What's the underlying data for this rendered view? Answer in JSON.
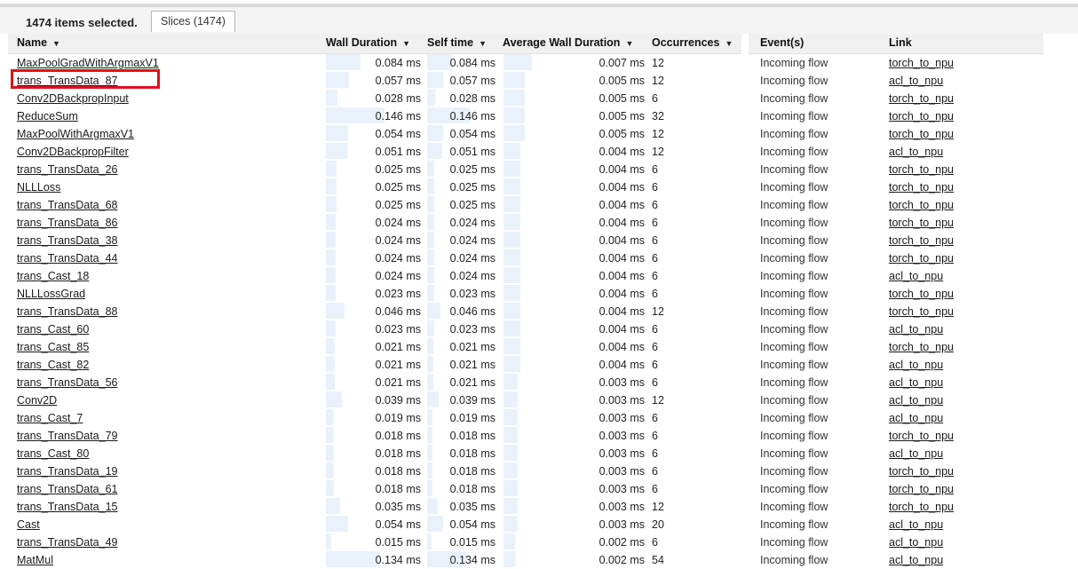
{
  "status": {
    "selected_text": "1474 items selected.",
    "tab_label": "Slices (1474)"
  },
  "table": {
    "headers": {
      "name": "Name",
      "wall": "Wall Duration",
      "self": "Self time",
      "avg": "Average Wall Duration",
      "occ": "Occurrences",
      "events": "Event(s)",
      "link": "Link"
    },
    "sort_arrow": "▼",
    "rows": [
      {
        "name": "MaxPoolGradWithArgmaxV1",
        "wall": "0.084 ms",
        "self": "0.084 ms",
        "avg": "0.007 ms",
        "occ": "12",
        "event": "Incoming flow",
        "link": "torch_to_npu",
        "wall_frac": 0.36,
        "avg_frac": 0.02
      },
      {
        "name": "trans_TransData_87",
        "wall": "0.057 ms",
        "self": "0.057 ms",
        "avg": "0.005 ms",
        "occ": "12",
        "event": "Incoming flow",
        "link": "acl_to_npu",
        "wall_frac": 0.24,
        "avg_frac": 0.015
      },
      {
        "name": "Conv2DBackpropInput",
        "wall": "0.028 ms",
        "self": "0.028 ms",
        "avg": "0.005 ms",
        "occ": "6",
        "event": "Incoming flow",
        "link": "torch_to_npu",
        "wall_frac": 0.12,
        "avg_frac": 0.015
      },
      {
        "name": "ReduceSum",
        "wall": "0.146 ms",
        "self": "0.146 ms",
        "avg": "0.005 ms",
        "occ": "32",
        "event": "Incoming flow",
        "link": "torch_to_npu",
        "wall_frac": 0.62,
        "avg_frac": 0.015
      },
      {
        "name": "MaxPoolWithArgmaxV1",
        "wall": "0.054 ms",
        "self": "0.054 ms",
        "avg": "0.005 ms",
        "occ": "12",
        "event": "Incoming flow",
        "link": "torch_to_npu",
        "wall_frac": 0.23,
        "avg_frac": 0.015
      },
      {
        "name": "Conv2DBackpropFilter",
        "wall": "0.051 ms",
        "self": "0.051 ms",
        "avg": "0.004 ms",
        "occ": "12",
        "event": "Incoming flow",
        "link": "acl_to_npu",
        "wall_frac": 0.22,
        "avg_frac": 0.012
      },
      {
        "name": "trans_TransData_26",
        "wall": "0.025 ms",
        "self": "0.025 ms",
        "avg": "0.004 ms",
        "occ": "6",
        "event": "Incoming flow",
        "link": "torch_to_npu",
        "wall_frac": 0.11,
        "avg_frac": 0.012
      },
      {
        "name": "NLLLoss",
        "wall": "0.025 ms",
        "self": "0.025 ms",
        "avg": "0.004 ms",
        "occ": "6",
        "event": "Incoming flow",
        "link": "torch_to_npu",
        "wall_frac": 0.11,
        "avg_frac": 0.012
      },
      {
        "name": "trans_TransData_68",
        "wall": "0.025 ms",
        "self": "0.025 ms",
        "avg": "0.004 ms",
        "occ": "6",
        "event": "Incoming flow",
        "link": "torch_to_npu",
        "wall_frac": 0.11,
        "avg_frac": 0.012
      },
      {
        "name": "trans_TransData_86",
        "wall": "0.024 ms",
        "self": "0.024 ms",
        "avg": "0.004 ms",
        "occ": "6",
        "event": "Incoming flow",
        "link": "torch_to_npu",
        "wall_frac": 0.1,
        "avg_frac": 0.012
      },
      {
        "name": "trans_TransData_38",
        "wall": "0.024 ms",
        "self": "0.024 ms",
        "avg": "0.004 ms",
        "occ": "6",
        "event": "Incoming flow",
        "link": "torch_to_npu",
        "wall_frac": 0.1,
        "avg_frac": 0.012
      },
      {
        "name": "trans_TransData_44",
        "wall": "0.024 ms",
        "self": "0.024 ms",
        "avg": "0.004 ms",
        "occ": "6",
        "event": "Incoming flow",
        "link": "torch_to_npu",
        "wall_frac": 0.1,
        "avg_frac": 0.012
      },
      {
        "name": "trans_Cast_18",
        "wall": "0.024 ms",
        "self": "0.024 ms",
        "avg": "0.004 ms",
        "occ": "6",
        "event": "Incoming flow",
        "link": "acl_to_npu",
        "wall_frac": 0.1,
        "avg_frac": 0.012
      },
      {
        "name": "NLLLossGrad",
        "wall": "0.023 ms",
        "self": "0.023 ms",
        "avg": "0.004 ms",
        "occ": "6",
        "event": "Incoming flow",
        "link": "torch_to_npu",
        "wall_frac": 0.1,
        "avg_frac": 0.012
      },
      {
        "name": "trans_TransData_88",
        "wall": "0.046 ms",
        "self": "0.046 ms",
        "avg": "0.004 ms",
        "occ": "12",
        "event": "Incoming flow",
        "link": "torch_to_npu",
        "wall_frac": 0.2,
        "avg_frac": 0.012
      },
      {
        "name": "trans_Cast_60",
        "wall": "0.023 ms",
        "self": "0.023 ms",
        "avg": "0.004 ms",
        "occ": "6",
        "event": "Incoming flow",
        "link": "acl_to_npu",
        "wall_frac": 0.1,
        "avg_frac": 0.012
      },
      {
        "name": "trans_Cast_85",
        "wall": "0.021 ms",
        "self": "0.021 ms",
        "avg": "0.004 ms",
        "occ": "6",
        "event": "Incoming flow",
        "link": "torch_to_npu",
        "wall_frac": 0.09,
        "avg_frac": 0.012
      },
      {
        "name": "trans_Cast_82",
        "wall": "0.021 ms",
        "self": "0.021 ms",
        "avg": "0.004 ms",
        "occ": "6",
        "event": "Incoming flow",
        "link": "acl_to_npu",
        "wall_frac": 0.09,
        "avg_frac": 0.012
      },
      {
        "name": "trans_TransData_56",
        "wall": "0.021 ms",
        "self": "0.021 ms",
        "avg": "0.003 ms",
        "occ": "6",
        "event": "Incoming flow",
        "link": "acl_to_npu",
        "wall_frac": 0.09,
        "avg_frac": 0.01
      },
      {
        "name": "Conv2D",
        "wall": "0.039 ms",
        "self": "0.039 ms",
        "avg": "0.003 ms",
        "occ": "12",
        "event": "Incoming flow",
        "link": "acl_to_npu",
        "wall_frac": 0.17,
        "avg_frac": 0.01
      },
      {
        "name": "trans_Cast_7",
        "wall": "0.019 ms",
        "self": "0.019 ms",
        "avg": "0.003 ms",
        "occ": "6",
        "event": "Incoming flow",
        "link": "acl_to_npu",
        "wall_frac": 0.08,
        "avg_frac": 0.01
      },
      {
        "name": "trans_TransData_79",
        "wall": "0.018 ms",
        "self": "0.018 ms",
        "avg": "0.003 ms",
        "occ": "6",
        "event": "Incoming flow",
        "link": "torch_to_npu",
        "wall_frac": 0.08,
        "avg_frac": 0.01
      },
      {
        "name": "trans_Cast_80",
        "wall": "0.018 ms",
        "self": "0.018 ms",
        "avg": "0.003 ms",
        "occ": "6",
        "event": "Incoming flow",
        "link": "acl_to_npu",
        "wall_frac": 0.08,
        "avg_frac": 0.01
      },
      {
        "name": "trans_TransData_19",
        "wall": "0.018 ms",
        "self": "0.018 ms",
        "avg": "0.003 ms",
        "occ": "6",
        "event": "Incoming flow",
        "link": "torch_to_npu",
        "wall_frac": 0.08,
        "avg_frac": 0.01
      },
      {
        "name": "trans_TransData_61",
        "wall": "0.018 ms",
        "self": "0.018 ms",
        "avg": "0.003 ms",
        "occ": "6",
        "event": "Incoming flow",
        "link": "torch_to_npu",
        "wall_frac": 0.08,
        "avg_frac": 0.01
      },
      {
        "name": "trans_TransData_15",
        "wall": "0.035 ms",
        "self": "0.035 ms",
        "avg": "0.003 ms",
        "occ": "12",
        "event": "Incoming flow",
        "link": "torch_to_npu",
        "wall_frac": 0.15,
        "avg_frac": 0.01
      },
      {
        "name": "Cast",
        "wall": "0.054 ms",
        "self": "0.054 ms",
        "avg": "0.003 ms",
        "occ": "20",
        "event": "Incoming flow",
        "link": "acl_to_npu",
        "wall_frac": 0.23,
        "avg_frac": 0.01
      },
      {
        "name": "trans_TransData_49",
        "wall": "0.015 ms",
        "self": "0.015 ms",
        "avg": "0.002 ms",
        "occ": "6",
        "event": "Incoming flow",
        "link": "acl_to_npu",
        "wall_frac": 0.06,
        "avg_frac": 0.008
      },
      {
        "name": "MatMul",
        "wall": "0.134 ms",
        "self": "0.134 ms",
        "avg": "0.002 ms",
        "occ": "54",
        "event": "Incoming flow",
        "link": "acl_to_npu",
        "wall_frac": 0.57,
        "avg_frac": 0.008
      }
    ]
  },
  "colors": {
    "bar_fill": "#e9f1fb",
    "highlight": "#e01212",
    "header_bg": "#f0f0f0"
  }
}
